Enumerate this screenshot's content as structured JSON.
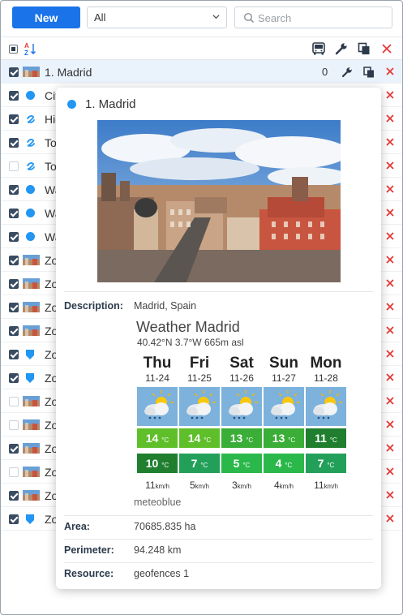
{
  "toolbar": {
    "new_label": "New",
    "filter_value": "All",
    "search_placeholder": "Search"
  },
  "header": {
    "sort_icon": "sort-az-icon",
    "icons": [
      "bus-icon",
      "wrench-icon",
      "copy-icon",
      "close-icon"
    ]
  },
  "rows": [
    {
      "text": "1. Madrid",
      "checked": true,
      "icon": "photo",
      "count": "0"
    },
    {
      "text": "Cit",
      "checked": true,
      "icon": "dot"
    },
    {
      "text": "Hig",
      "checked": true,
      "icon": "route"
    },
    {
      "text": "To",
      "checked": true,
      "icon": "route"
    },
    {
      "text": "To",
      "checked": false,
      "icon": "route"
    },
    {
      "text": "Wa",
      "checked": true,
      "icon": "dot"
    },
    {
      "text": "Wa",
      "checked": true,
      "icon": "dot"
    },
    {
      "text": "Wa",
      "checked": true,
      "icon": "dot"
    },
    {
      "text": "Zo",
      "checked": true,
      "icon": "photo"
    },
    {
      "text": "Zo",
      "checked": true,
      "icon": "photo"
    },
    {
      "text": "Zo",
      "checked": true,
      "icon": "photo"
    },
    {
      "text": "Zo",
      "checked": true,
      "icon": "photo"
    },
    {
      "text": "Zo",
      "checked": true,
      "icon": "pin"
    },
    {
      "text": "Zo",
      "checked": true,
      "icon": "pin"
    },
    {
      "text": "Zo",
      "checked": false,
      "icon": "photo"
    },
    {
      "text": "Zo",
      "checked": false,
      "icon": "photo"
    },
    {
      "text": "Zo",
      "checked": true,
      "icon": "photo"
    },
    {
      "text": "Zo",
      "checked": false,
      "icon": "photo"
    },
    {
      "text": "Zo",
      "checked": true,
      "icon": "photo"
    },
    {
      "text": "Zo",
      "checked": true,
      "icon": "pin"
    }
  ],
  "popup": {
    "title": "1. Madrid",
    "description_label": "Description:",
    "description": "Madrid, Spain",
    "weather_title": "Weather Madrid",
    "weather_coords": "40.42°N 3.7°W 665m asl",
    "days": [
      {
        "name": "Thu",
        "date": "11-24",
        "max": "14",
        "min": "10",
        "wind": "11",
        "max_color": "#5fbf2a",
        "min_color": "#1f7f2f"
      },
      {
        "name": "Fri",
        "date": "11-25",
        "max": "14",
        "min": "7",
        "wind": "5",
        "max_color": "#5fbf2a",
        "min_color": "#22a05a"
      },
      {
        "name": "Sat",
        "date": "11-26",
        "max": "13",
        "min": "5",
        "wind": "3",
        "max_color": "#3aae36",
        "min_color": "#2ab84a"
      },
      {
        "name": "Sun",
        "date": "11-27",
        "max": "13",
        "min": "4",
        "wind": "4",
        "max_color": "#3aae36",
        "min_color": "#2ab84a"
      },
      {
        "name": "Mon",
        "date": "11-28",
        "max": "11",
        "min": "7",
        "wind": "11",
        "max_color": "#1f7f2f",
        "min_color": "#22a05a"
      }
    ],
    "temp_unit": "°C",
    "wind_unit": "km/h",
    "meteo_credit": "meteoblue",
    "area_label": "Area:",
    "area": "70685.835 ha",
    "perimeter_label": "Perimeter:",
    "perimeter": "94.248 km",
    "resource_label": "Resource:",
    "resource": "geofences 1"
  },
  "colors": {
    "accent": "#1a73e8",
    "delete": "#e53935",
    "selected_row": "#eaf3fc",
    "dot": "#2196f3"
  }
}
